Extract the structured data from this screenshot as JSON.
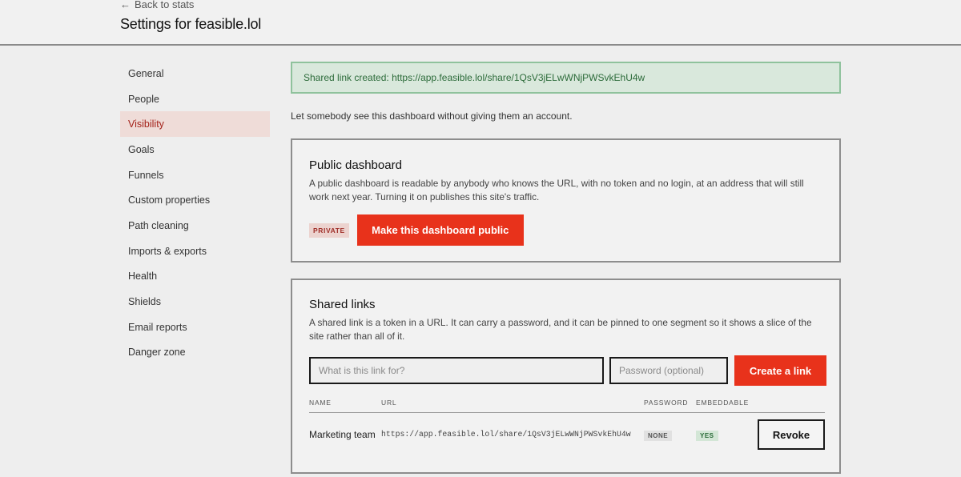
{
  "header": {
    "back_label": "Back to stats",
    "title": "Settings for feasible.lol"
  },
  "sidebar": {
    "active": "Visibility",
    "items": [
      {
        "label": "General"
      },
      {
        "label": "People"
      },
      {
        "label": "Visibility"
      },
      {
        "label": "Goals"
      },
      {
        "label": "Funnels"
      },
      {
        "label": "Custom properties"
      },
      {
        "label": "Path cleaning"
      },
      {
        "label": "Imports & exports"
      },
      {
        "label": "Health"
      },
      {
        "label": "Shields"
      },
      {
        "label": "Email reports"
      },
      {
        "label": "Danger zone"
      }
    ]
  },
  "flash": {
    "message": "Shared link created: https://app.feasible.lol/share/1QsV3jELwWNjPWSvkEhU4w"
  },
  "intro": "Let somebody see this dashboard without giving them an account.",
  "public_dashboard": {
    "title": "Public dashboard",
    "description": "A public dashboard is readable by anybody who knows the URL, with no token and no login, at an address that will still work next year. Turning it on publishes this site's traffic.",
    "status_badge": "PRIVATE",
    "make_public_label": "Make this dashboard public"
  },
  "shared_links": {
    "title": "Shared links",
    "description": "A shared link is a token in a URL. It can carry a password, and it can be pinned to one segment so it shows a slice of the site rather than all of it.",
    "purpose_placeholder": "What is this link for?",
    "password_placeholder": "Password (optional)",
    "create_label": "Create a link",
    "columns": [
      "NAME",
      "URL",
      "PASSWORD",
      "EMBEDDABLE"
    ],
    "rows": [
      {
        "name": "Marketing team",
        "url": "https://app.feasible.lol/share/1QsV3jELwWNjPWSvkEhU4w",
        "password": "NONE",
        "embeddable": "YES",
        "action_label": "Revoke"
      }
    ]
  },
  "colors": {
    "accent": "#e8321b",
    "active_bg": "#efdcd8",
    "active_text": "#a4221a",
    "success_bg": "#d9e8dc",
    "success_border": "#8fc29c"
  },
  "icons": {
    "back": "arrow-left-icon"
  }
}
